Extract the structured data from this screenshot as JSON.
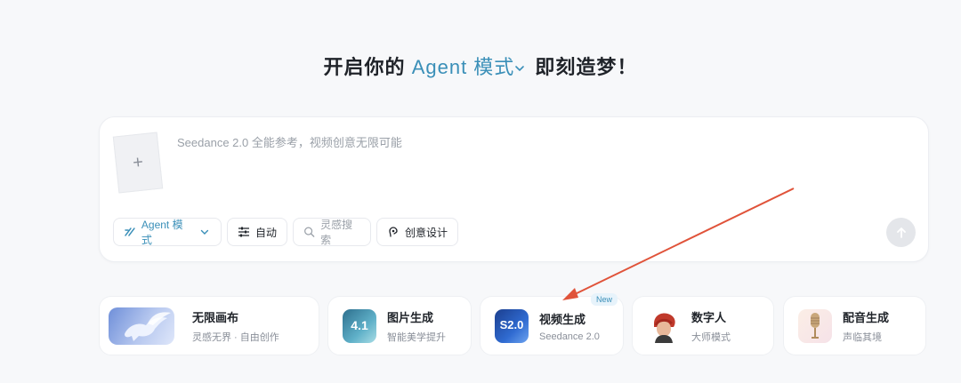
{
  "headline": {
    "prefix": "开启你的",
    "agent": "Agent 模式",
    "suffix": "即刻造梦！"
  },
  "composer": {
    "placeholder": "Seedance 2.0 全能参考，视频创意无限可能",
    "upload_symbol": "+",
    "toolbar": [
      {
        "label": "Agent 模式",
        "icon": "agent-icon"
      },
      {
        "label": "自动",
        "icon": "sliders-icon"
      },
      {
        "label": "灵感搜索",
        "icon": "search-icon"
      },
      {
        "label": "创意设计",
        "icon": "design-icon"
      }
    ],
    "send_icon": "arrow-up-icon"
  },
  "cards": [
    {
      "title": "无限画布",
      "subtitle": "灵感无界 · 自由创作",
      "icon": "pegasus-thumbnail"
    },
    {
      "title": "图片生成",
      "subtitle": "智能美学提升",
      "icon": "image-gen-thumbnail",
      "thumb_text": "4.1"
    },
    {
      "title": "视频生成",
      "subtitle": "Seedance 2.0",
      "icon": "video-gen-thumbnail",
      "thumb_text": "S2.0",
      "badge": "New"
    },
    {
      "title": "数字人",
      "subtitle": "大师模式",
      "icon": "digital-human-thumbnail"
    },
    {
      "title": "配音生成",
      "subtitle": "声临其境",
      "icon": "microphone-thumbnail"
    }
  ],
  "colors": {
    "accent": "#3a8fb8",
    "arrow": "#e0533a",
    "background": "#f7f8fa"
  }
}
